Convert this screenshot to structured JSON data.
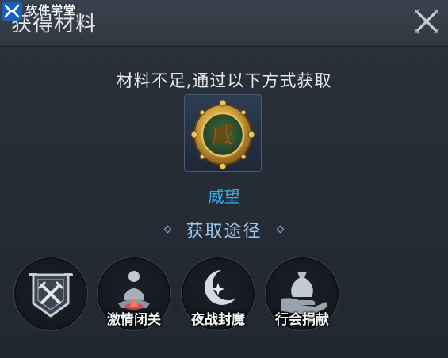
{
  "header": {
    "title": "获得材料",
    "watermark_text": "软件学堂",
    "close_icon": "close-x-icon"
  },
  "main": {
    "subtitle": "材料不足,通过以下方式获取",
    "item": {
      "name": "威望",
      "emblem_char": "威",
      "icon": "prestige-medal-icon"
    },
    "section_title": "获取途径",
    "ways": [
      {
        "label": "",
        "icon": "crossed-swords-banner-icon"
      },
      {
        "label": "激情闭关",
        "icon": "meditation-figure-icon"
      },
      {
        "label": "夜战封魔",
        "icon": "crescent-moon-star-icon"
      },
      {
        "label": "行会捐献",
        "icon": "money-bag-hand-icon"
      }
    ]
  },
  "colors": {
    "item_name": "#3cb1f0",
    "section_title": "#9cc8ec",
    "gold": "#d9b04a"
  }
}
